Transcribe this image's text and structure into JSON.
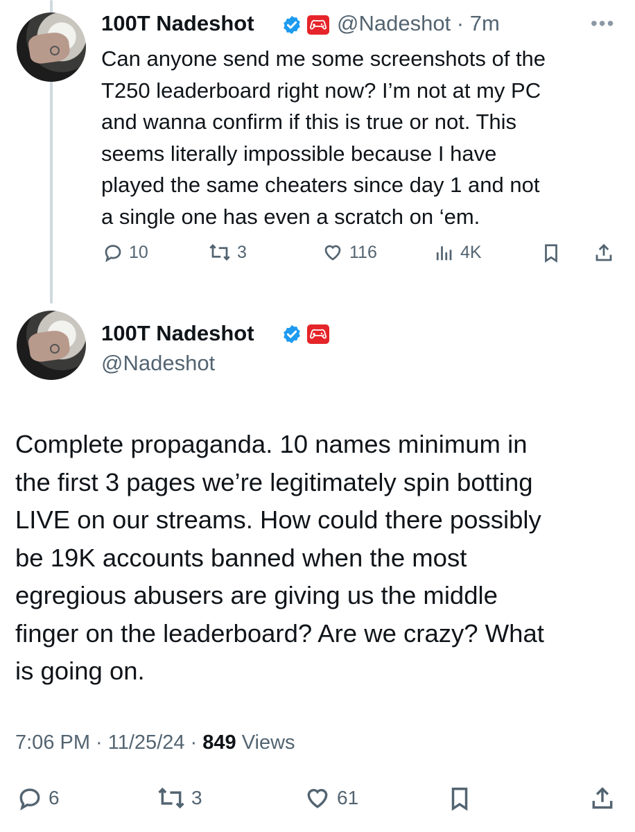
{
  "tweet1": {
    "display_name": "100T Nadeshot",
    "handle": "@Nadeshot",
    "time": "7m",
    "text": "Can anyone send me some screenshots of the\nT250 leaderboard right now? I’m not at my PC\nand wanna confirm if this is true or not.  This\nseems literally impossible because I have\nplayed the same cheaters since day 1 and not\na single one has even a scratch on ‘em.",
    "replies": "10",
    "reposts": "3",
    "likes": "116",
    "views": "4K"
  },
  "tweet2": {
    "display_name": "100T Nadeshot",
    "handle": "@Nadeshot",
    "text": "Complete propaganda. 10 names minimum in\nthe first 3 pages we’re legitimately spin botting\nLIVE on our streams. How could there possibly\nbe 19K accounts banned when the most\negregious abusers are giving us the middle\nfinger on the leaderboard? Are we crazy? What\nis going on.",
    "timestamp": "7:06 PM · 11/25/24 · ",
    "views_count": "849",
    "views_label": " Views",
    "replies": "6",
    "reposts": "3",
    "likes": "61"
  },
  "icons": {
    "verified": "verified-badge-icon",
    "affiliate": "gamepad-badge-icon",
    "reply": "reply-icon",
    "repost": "repost-icon",
    "like": "heart-icon",
    "views": "views-icon",
    "bookmark": "bookmark-icon",
    "share": "share-icon",
    "more": "more-icon"
  },
  "colors": {
    "verified": "#1d9bf0",
    "badge": "#e5252a",
    "text": "#0f1419",
    "secondary": "#536471"
  }
}
